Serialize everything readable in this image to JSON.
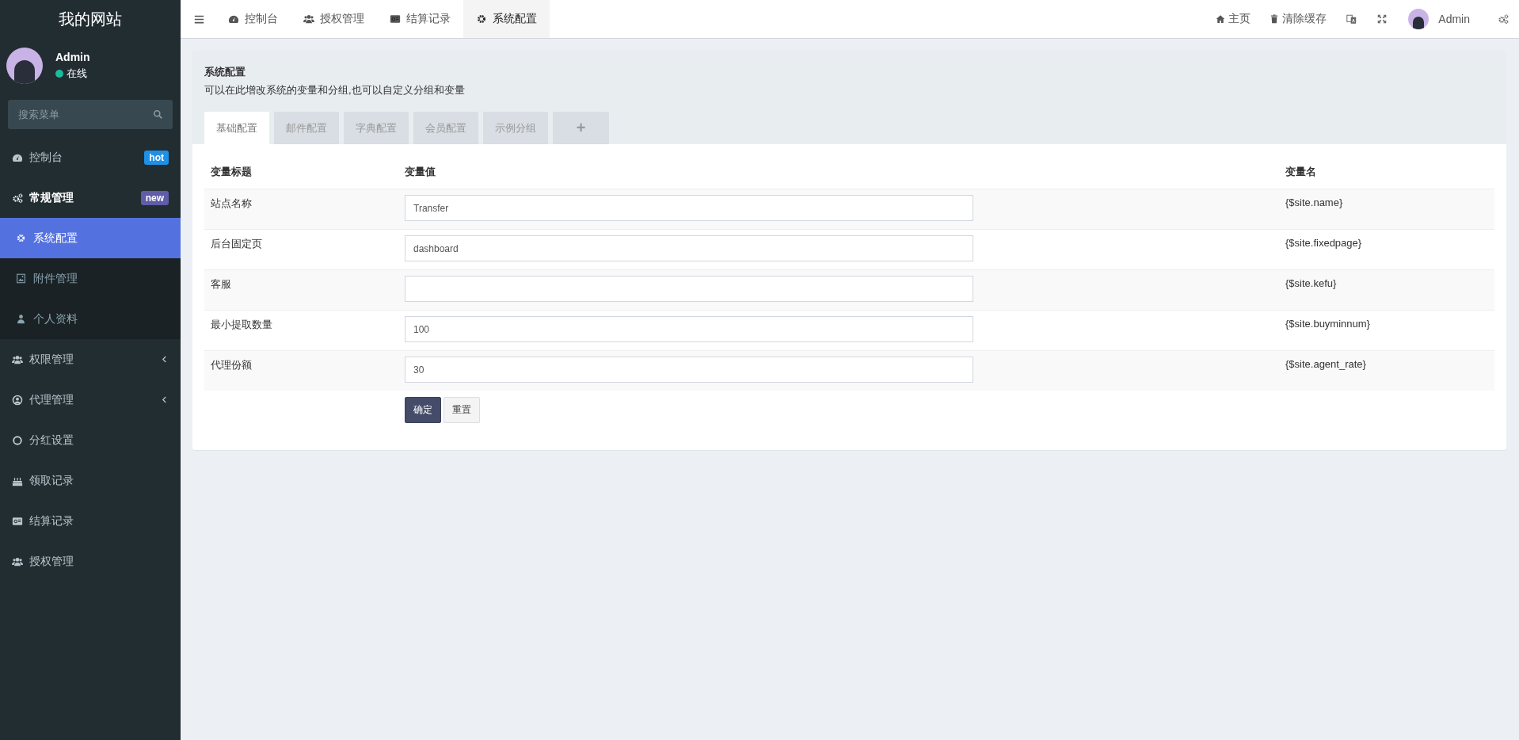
{
  "sidebar": {
    "title": "我的网站",
    "user": {
      "name": "Admin",
      "status": "在线"
    },
    "search": {
      "placeholder": "搜索菜单"
    },
    "items": [
      {
        "label": "控制台",
        "selected": false,
        "badge": {
          "text": "hot",
          "color": "#1e91e6"
        }
      },
      {
        "label": "常规管理",
        "selected": false,
        "expanded": true,
        "badge": {
          "text": "new",
          "color": "#605ca8"
        },
        "children": [
          {
            "label": "系统配置",
            "selected": true
          },
          {
            "label": "附件管理",
            "selected": false
          },
          {
            "label": "个人资料",
            "selected": false
          }
        ]
      },
      {
        "label": "权限管理",
        "selected": false,
        "expanded": false
      },
      {
        "label": "代理管理",
        "selected": false,
        "expanded": false
      },
      {
        "label": "分红设置",
        "selected": false
      },
      {
        "label": "领取记录",
        "selected": false
      },
      {
        "label": "结算记录",
        "selected": false
      },
      {
        "label": "授权管理",
        "selected": false
      }
    ]
  },
  "topbar": {
    "tabs": [
      {
        "label": "控制台",
        "selected": false
      },
      {
        "label": "授权管理",
        "selected": false
      },
      {
        "label": "结算记录",
        "selected": false
      },
      {
        "label": "系统配置",
        "selected": true
      }
    ],
    "links": [
      "主页",
      "清除缓存"
    ],
    "user": "Admin"
  },
  "panel": {
    "title": "系统配置",
    "description": "可以在此增改系统的变量和分组,也可以自定义分组和变量",
    "tabs": [
      {
        "label": "基础配置",
        "selected": true
      },
      {
        "label": "邮件配置",
        "selected": false
      },
      {
        "label": "字典配置",
        "selected": false
      },
      {
        "label": "会员配置",
        "selected": false
      },
      {
        "label": "示例分组",
        "selected": false
      }
    ],
    "add_tab": "+",
    "table": {
      "columns": [
        "变量标题",
        "变量值",
        "变量名"
      ],
      "rows": [
        {
          "title": "站点名称",
          "value": "Transfer",
          "variable": "{$site.name}"
        },
        {
          "title": "后台固定页",
          "value": "dashboard",
          "variable": "{$site.fixedpage}"
        },
        {
          "title": "客服",
          "variable": "{$site.kefu}"
        },
        {
          "title": "最小提取数量",
          "value": "100",
          "variable": "{$site.buyminnum}"
        },
        {
          "title": "代理份额",
          "value": "30",
          "variable": "{$site.agent_rate}"
        }
      ]
    },
    "buttons": [
      {
        "label": "确定",
        "kind": "primary"
      },
      {
        "label": "重置",
        "kind": "default"
      }
    ]
  }
}
